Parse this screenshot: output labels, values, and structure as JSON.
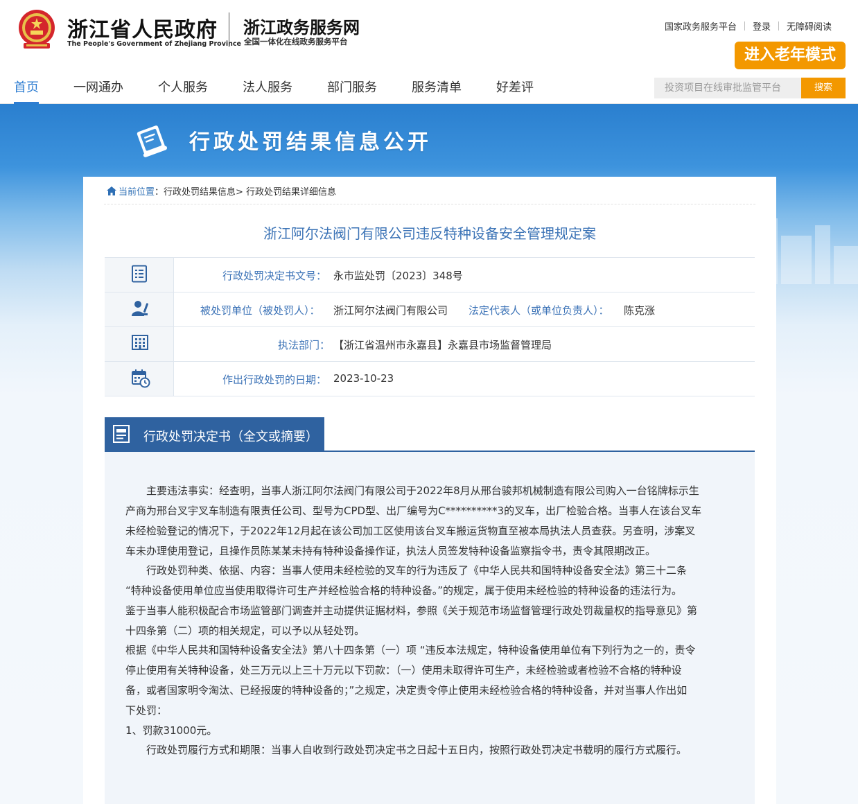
{
  "header": {
    "brand_cn": "浙江省人民政府",
    "brand_en": "The People's Government of Zhejiang Province",
    "site_cn": "浙江政务服务网",
    "site_sub": "全国一体化在线政务服务平台",
    "top_links": [
      "国家政务服务平台",
      "登录",
      "无障碍阅读"
    ],
    "elder_mode": "进入老年模式"
  },
  "nav": {
    "items": [
      "首页",
      "一网通办",
      "个人服务",
      "法人服务",
      "部门服务",
      "服务清单",
      "好差评"
    ],
    "active": "首页",
    "search_placeholder": "投资项目在线审批监管平台",
    "search_button": "搜索"
  },
  "banner": {
    "title": "行政处罚结果信息公开"
  },
  "breadcrumb": {
    "prefix": "当前位置",
    "path": "：行政处罚结果信息> 行政处罚结果详细信息"
  },
  "case": {
    "title": "浙江阿尔法阀门有限公司违反特种设备安全管理规定案",
    "rows": [
      {
        "icon": "document-list-icon",
        "label": "行政处罚决定书文号：",
        "value": "永市监处罚〔2023〕348号"
      },
      {
        "icon": "person-icon",
        "label": "被处罚单位（被处罚人）：",
        "value": "浙江阿尔法阀门有限公司",
        "label2": "法定代表人（或单位负责人）：",
        "value2": "陈克涨"
      },
      {
        "icon": "building-icon",
        "label": "执法部门：",
        "value": "【浙江省温州市永嘉县】永嘉县市场监督管理局"
      },
      {
        "icon": "calendar-clock-icon",
        "label": "作出行政处罚的日期：",
        "value": "2023-10-23"
      }
    ]
  },
  "decision": {
    "section_title": "行政处罚决定书（全文或摘要）",
    "lines": [
      "　　主要违法事实：经查明，当事人浙江阿尔法阀门有限公司于2022年8月从邢台骏邦机械制造有限公司购入一台铭牌标示生",
      "产商为邢台叉宇叉车制造有限责任公司、型号为CPD型、出厂编号为C**********3的叉车，出厂检验合格。当事人在该台叉车",
      "未经检验登记的情况下，于2022年12月起在该公司加工区使用该台叉车搬运货物直至被本局执法人员查获。另查明，涉案叉",
      "车未办理使用登记，且操作员陈某某未持有特种设备操作证，执法人员签发特种设备监察指令书，责令其限期改正。",
      "　　行政处罚种类、依据、内容：当事人使用未经检验的叉车的行为违反了《中华人民共和国特种设备安全法》第三十二条",
      "“特种设备使用单位应当使用取得许可生产并经检验合格的特种设备。”的规定，属于使用未经检验的特种设备的违法行为。",
      "鉴于当事人能积极配合市场监管部门调查并主动提供证据材料，参照《关于规范市场监督管理行政处罚裁量权的指导意见》第",
      "十四条第（二）项的相关规定，可以予以从轻处罚。",
      "根据《中华人民共和国特种设备安全法》第八十四条第（一）项 “违反本法规定，特种设备使用单位有下列行为之一的，责令",
      "停止使用有关特种设备，处三万元以上三十万元以下罚款：（一）使用未取得许可生产，未经检验或者检验不合格的特种设",
      "备，或者国家明令淘汰、已经报废的特种设备的；”之规定，决定责令停止使用未经检验合格的特种设备，并对当事人作出如",
      "下处罚：",
      "1、罚款31000元。",
      "　　行政处罚履行方式和期限：当事人自收到行政处罚决定书之日起十五日内，按照行政处罚决定书载明的履行方式履行。"
    ]
  },
  "colors": {
    "accent_blue": "#2e7dd1",
    "label_blue": "#3c73b7",
    "tab_blue": "#2f62a0",
    "orange": "#f39800"
  }
}
